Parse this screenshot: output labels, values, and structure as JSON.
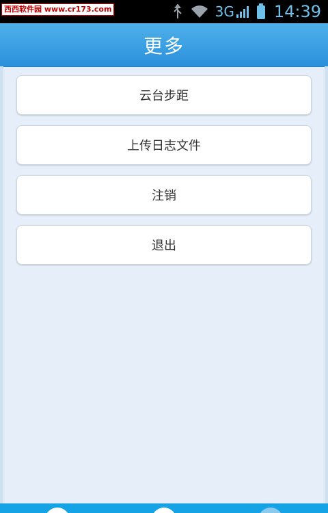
{
  "watermark": "西西软件园 www.cr173.com",
  "status_bar": {
    "network": "3G",
    "time": "14:39",
    "icons": [
      "usb-debug-icon",
      "wifi-icon",
      "signal-icon",
      "battery-icon"
    ]
  },
  "header": {
    "title": "更多"
  },
  "menu": {
    "items": [
      {
        "label": "云台步距"
      },
      {
        "label": "上传日志文件"
      },
      {
        "label": "注销"
      },
      {
        "label": "退出"
      }
    ]
  },
  "colors": {
    "header": "#2a90db",
    "background": "#e6eff9",
    "bottom_bar": "#16a3e6"
  }
}
